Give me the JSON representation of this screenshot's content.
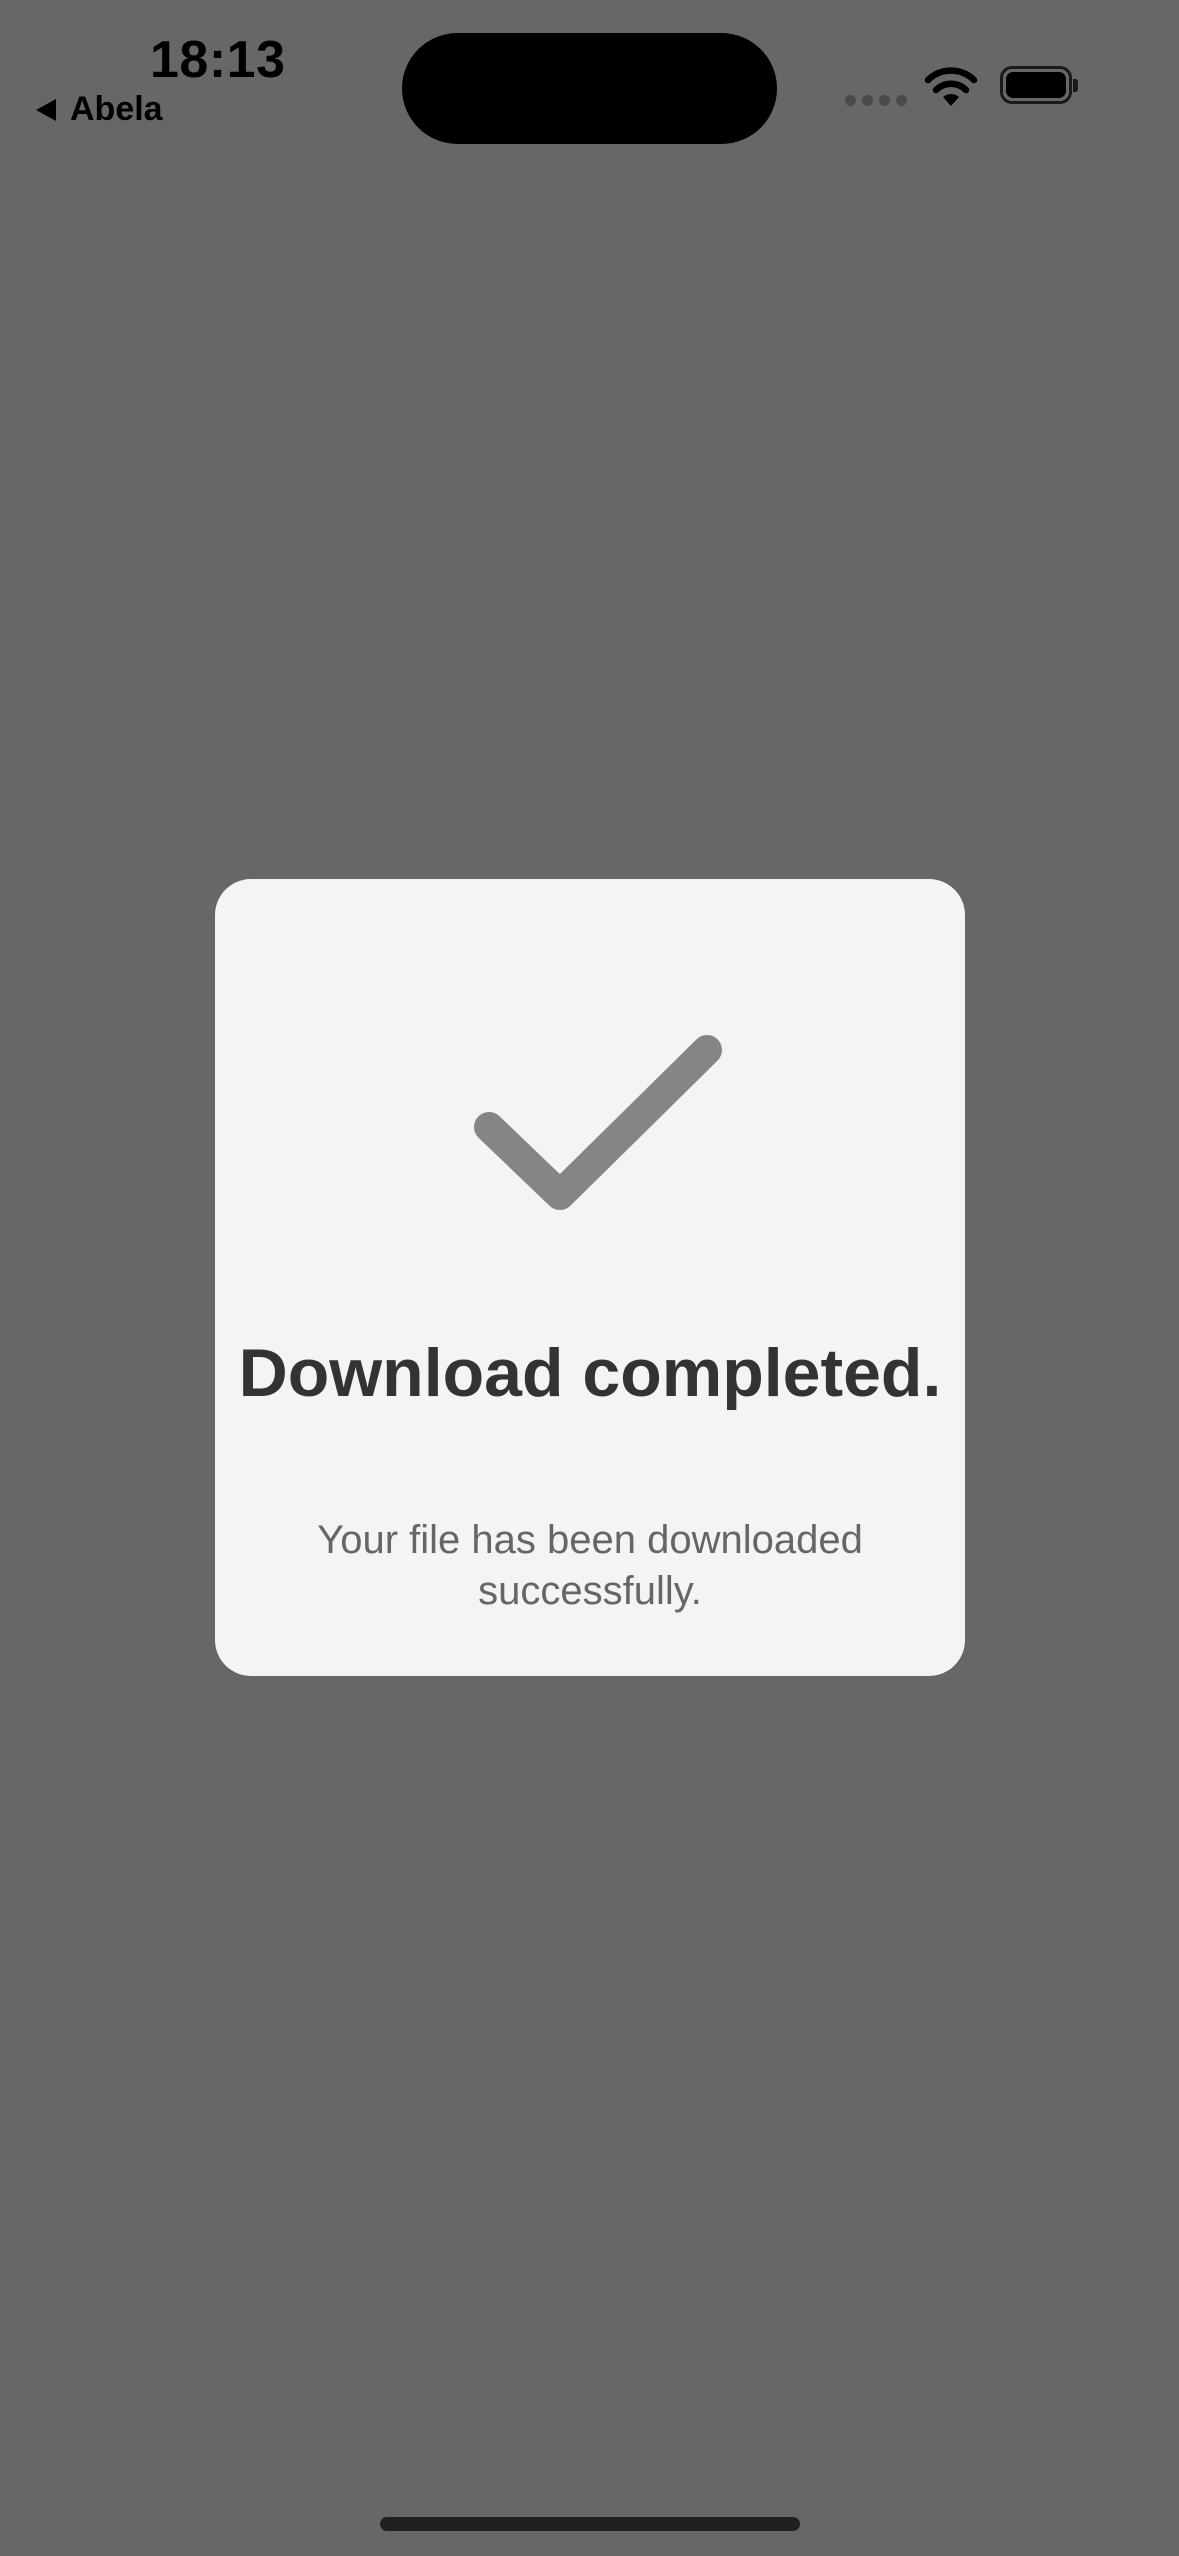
{
  "status_bar": {
    "time": "18:13",
    "back_app_label": "Abela"
  },
  "dialog": {
    "icon": "checkmark-icon",
    "title": "Download completed.",
    "message": "Your file has been downloaded successfully."
  },
  "colors": {
    "background_dim": "#676767",
    "dialog_background": "#f4f4f4",
    "checkmark": "#858585",
    "title_text": "#333333",
    "message_text": "#666666"
  }
}
